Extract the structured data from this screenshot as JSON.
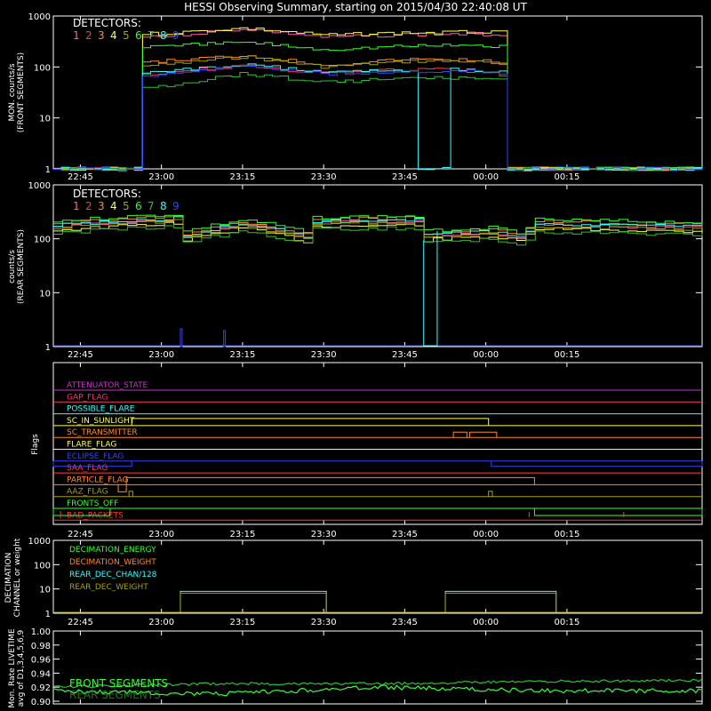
{
  "title": "HESSI Observing Summary, starting on 2015/04/30 22:40:08 UT",
  "time_ticks": [
    "22:45",
    "23:00",
    "23:15",
    "23:30",
    "23:45",
    "00:00",
    "00:15"
  ],
  "detector_label": "DETECTORS:",
  "detectors": [
    {
      "label": "1",
      "color": "#ff5ca8"
    },
    {
      "label": "2",
      "color": "#ff3a3a"
    },
    {
      "label": "3",
      "color": "#ff8a2a"
    },
    {
      "label": "4",
      "color": "#ffff50"
    },
    {
      "label": "5",
      "color": "#a8a000"
    },
    {
      "label": "6",
      "color": "#33ff33"
    },
    {
      "label": "7",
      "color": "#2fc02f"
    },
    {
      "label": "8",
      "color": "#33ffff"
    },
    {
      "label": "9",
      "color": "#3344ff"
    }
  ],
  "colors": {
    "front_rate": [
      "#ff5ca8",
      "#ff3a3a",
      "#ff8a2a",
      "#ffff50",
      "#a8a000",
      "#33ff33",
      "#2fc02f",
      "#33ffff",
      "#3344ff"
    ]
  },
  "chart_data": [
    {
      "type": "line",
      "panel": "front",
      "ylabel": "MON. counts/s\n(FRONT SEGMENTS)",
      "yscale": "log",
      "ylim": [
        1,
        1000
      ],
      "yticks": [
        "1",
        "10",
        "100",
        "1000"
      ],
      "x": [
        "22:40",
        "22:52",
        "23:00",
        "23:15",
        "23:30",
        "23:45",
        "23:50",
        "23:56",
        "00:03",
        "00:05",
        "00:20"
      ],
      "series": [
        {
          "name": "1",
          "values": [
            1,
            1,
            400,
            560,
            380,
            430,
            430,
            450,
            430,
            1,
            1
          ]
        },
        {
          "name": "2",
          "values": [
            1,
            1,
            75,
            105,
            75,
            88,
            88,
            85,
            70,
            1,
            1
          ]
        },
        {
          "name": "3",
          "values": [
            1,
            1,
            130,
            170,
            110,
            140,
            140,
            140,
            120,
            1,
            1
          ]
        },
        {
          "name": "4",
          "values": [
            1,
            1,
            450,
            580,
            420,
            470,
            470,
            480,
            470,
            1,
            1
          ]
        },
        {
          "name": "5",
          "values": [
            1,
            1,
            110,
            160,
            100,
            130,
            130,
            130,
            110,
            1,
            1
          ]
        },
        {
          "name": "6",
          "values": [
            1,
            1,
            250,
            310,
            220,
            260,
            260,
            270,
            250,
            1,
            1
          ]
        },
        {
          "name": "7",
          "values": [
            1,
            1,
            42,
            75,
            50,
            60,
            60,
            62,
            55,
            1,
            1
          ]
        },
        {
          "name": "8",
          "values": [
            1,
            1,
            80,
            110,
            80,
            88,
            1,
            90,
            80,
            1,
            1
          ]
        },
        {
          "name": "9",
          "values": [
            1,
            1,
            70,
            105,
            72,
            82,
            82,
            85,
            70,
            1,
            1
          ]
        }
      ]
    },
    {
      "type": "line",
      "panel": "rear",
      "ylabel": "counts/s\n(REAR SEGMENTS)",
      "yscale": "log",
      "ylim": [
        1,
        1000
      ],
      "yticks": [
        "1",
        "10",
        "100",
        "1000"
      ],
      "x": [
        "22:40",
        "23:03",
        "23:04",
        "23:15",
        "23:27",
        "23:28",
        "23:47",
        "23:48",
        "00:00",
        "00:07",
        "00:08",
        "00:20"
      ],
      "series": [
        {
          "name": "rear",
          "values": [
            170,
            230,
            110,
            180,
            100,
            200,
            210,
            110,
            130,
            100,
            180,
            160
          ]
        }
      ]
    },
    {
      "type": "line",
      "panel": "flags",
      "ylabel": "Flags",
      "flags": [
        {
          "name": "ATTENUATOR_STATE",
          "color": "#cc33cc"
        },
        {
          "name": "GAP_FLAG",
          "color": "#ff3366"
        },
        {
          "name": "POSSIBLE_FLARE",
          "color": "#33ffff"
        },
        {
          "name": "SC_IN_SUNLIGHT",
          "color": "#ffff50"
        },
        {
          "name": "SC_TRANSMITTER",
          "color": "#ff8a2a"
        },
        {
          "name": "FLARE_FLAG",
          "color": "#ffff50"
        },
        {
          "name": "ECLIPSE_FLAG",
          "color": "#3344ff"
        },
        {
          "name": "SAA_FLAG",
          "color": "#ff3a3a"
        },
        {
          "name": "PARTICLE_FLAG",
          "color": "#ff8a2a"
        },
        {
          "name": "AAZ_FLAG",
          "color": "#a8a000"
        },
        {
          "name": "FRONTS_OFF",
          "color": "#33ff33"
        },
        {
          "name": "BAD_PACKETS",
          "color": "#ff3a3a"
        }
      ]
    },
    {
      "type": "line",
      "panel": "decimation",
      "ylabel": "DECIMATION\nCHANNEL or weight",
      "yscale": "log",
      "ylim": [
        1,
        1000
      ],
      "yticks": [
        "1",
        "10",
        "100",
        "1000"
      ],
      "series": [
        {
          "name": "DECIMATION_ENERGY",
          "color": "#33ff33"
        },
        {
          "name": "DECIMATION_WEIGHT",
          "color": "#ff8a2a"
        },
        {
          "name": "REAR_DEC_CHAN/128",
          "color": "#33ffff"
        },
        {
          "name": "REAR_DEC_WEIGHT",
          "color": "#a8a000"
        }
      ]
    },
    {
      "type": "line",
      "panel": "livetime",
      "ylabel": "Mon. Rate LIVETIME\navg of D1,3,4,5,6,9",
      "ylim": [
        0.9,
        1.0
      ],
      "yticks": [
        "0.90",
        "0.92",
        "0.94",
        "0.96",
        "0.98",
        "1.00"
      ],
      "series": [
        {
          "name": "FRONT SEGMENTS",
          "color": "#33ff33",
          "values": [
            0.915,
            0.91,
            0.92,
            0.915,
            0.915
          ]
        },
        {
          "name": "REAR SEGMENTS",
          "color": "#2fc02f",
          "values": [
            0.92,
            0.925,
            0.925,
            0.928,
            0.93
          ]
        }
      ]
    }
  ]
}
